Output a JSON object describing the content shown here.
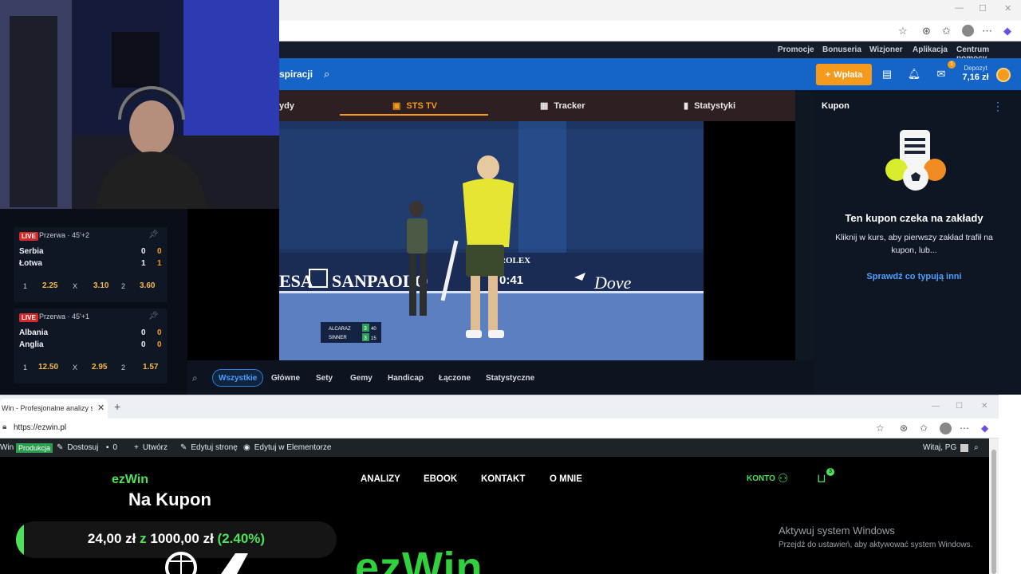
{
  "top_browser": {
    "window_controls": {
      "minimize": "—",
      "maximize": "☐",
      "close": "✕"
    },
    "address_icons": [
      "star-icon",
      "tracking-icon",
      "favorites-icon",
      "profile-avatar",
      "more-icon",
      "copilot-icon"
    ]
  },
  "sts": {
    "topnav": [
      "Promocje",
      "Bonuseria",
      "Wizjoner",
      "Aplikacja",
      "Centrum pomocy"
    ],
    "bluebar": {
      "inspiracje": "spiracji",
      "wplata": "Wpłata",
      "notif_badge": "1",
      "deposit_label": "Depozyt",
      "deposit_value": "7,16 zł"
    },
    "tabs": {
      "left_cut": "ydy",
      "ststv": "STS TV",
      "tracker": "Tracker",
      "statystyki": "Statystyki"
    },
    "video": {
      "banner_left": "ESA",
      "banner_sanpaolo": "SANPAOLO",
      "banner_rolex": "ROLEX",
      "clock": "0:41",
      "banner_dove": "Dove",
      "scoreboard": [
        {
          "name": "ALCARAZ",
          "set": "3",
          "game": "40"
        },
        {
          "name": "SINNER",
          "set": "3",
          "game": "15"
        }
      ]
    },
    "market_filters": [
      "Wszystkie",
      "Główne",
      "Sety",
      "Gemy",
      "Handicap",
      "Łączone",
      "Statystyczne"
    ],
    "kupon": {
      "title": "Kupon",
      "empty_title": "Ten kupon czeka na zakłady",
      "empty_text": "Kliknij w kurs, aby pierwszy zakład trafił na kupon, lub...",
      "link": "Sprawdź co typują inni"
    },
    "matches": [
      {
        "live": "LIVE",
        "status": "Przerwa · 45'+2",
        "team1": "Serbia",
        "team1_a": "0",
        "team1_b": "0",
        "team2": "Łotwa",
        "team2_a": "1",
        "team2_b": "1",
        "odds": [
          {
            "label": "1",
            "value": "2.25"
          },
          {
            "label": "X",
            "value": "3.10"
          },
          {
            "label": "2",
            "value": "3.60"
          }
        ]
      },
      {
        "live": "LIVE",
        "status": "Przerwa · 45'+1",
        "team1": "Albania",
        "team1_a": "0",
        "team1_b": "0",
        "team2": "Anglia",
        "team2_a": "0",
        "team2_b": "0",
        "odds": [
          {
            "label": "1",
            "value": "12.50"
          },
          {
            "label": "X",
            "value": "2.95"
          },
          {
            "label": "2",
            "value": "1.57"
          }
        ]
      }
    ]
  },
  "bottom_browser": {
    "tab_title": "Win - Profesjonalne analizy spo",
    "tab_close": "✕",
    "new_tab": "+",
    "url": "https://ezwin.pl"
  },
  "wp_admin": {
    "site": "Win",
    "env": "Produkcja",
    "dostosuj": "Dostosuj",
    "comments_count": "0",
    "utworz": "Utwórz",
    "edytuj": "Edytuj stronę",
    "elementor": "Edytuj w Elementorze",
    "greeting": "Witaj, PG"
  },
  "ezwin": {
    "logo": "ezWin",
    "nav": [
      "ANALIZY",
      "EBOOK",
      "KONTAKT",
      "O MNIE"
    ],
    "konto": "KONTO",
    "cart_count": "3",
    "big_brand": "ezWin"
  },
  "windows_activation": {
    "title": "Aktywuj system Windows",
    "subtitle": "Przejdź do ustawień, aby aktywować system Windows."
  },
  "overlay": {
    "title": "Na Kupon",
    "current": "24,00 zł",
    "z": "z",
    "target": "1000,00 zł",
    "percent": "(2.40%)",
    "progress_fraction": 0.024
  },
  "colors": {
    "sts_blue": "#1565c8",
    "sts_orange": "#f59a1b",
    "ezwin_green": "#4ee15a"
  }
}
